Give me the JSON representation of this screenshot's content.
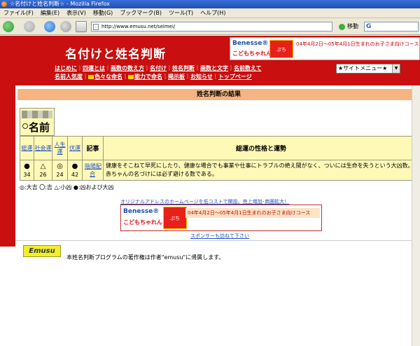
{
  "window": {
    "title": "☆名付けと姓名判断☆ - Mozilla Firefox"
  },
  "menubar": {
    "items": [
      "ファイル(F)",
      "編集(E)",
      "表示(V)",
      "移動(G)",
      "ブックマーク(B)",
      "ツール(T)",
      "ヘルプ(H)"
    ]
  },
  "navbar": {
    "url": "http://www.emusu.net/seimei/",
    "go_label": "移動",
    "search_logo": "G"
  },
  "header": {
    "site_title": "名付けと姓名判断",
    "site_menu": "★サイトメニュー★",
    "links_row1": [
      "はじめに",
      "四運とは",
      "画数の数え方",
      "名付け",
      "姓名判断",
      "画数と文字",
      "名前数えて"
    ],
    "links_row2": [
      "名前人気度",
      "色々な命名",
      "能力で命名",
      "掲示板",
      "お知らせ",
      "トップページ"
    ],
    "tag_new": "NEW",
    "tag_cool": "COOL"
  },
  "ad_top": {
    "brand": "Benesse®",
    "product": "こどもちゃれんじ",
    "tag": "ぷち",
    "text": "04年4月2日～05年4月1日生まれのお子さま向けコース"
  },
  "result": {
    "title": "姓名判断の結果",
    "name_label": "名前",
    "headers": [
      "総運",
      "社会運",
      "人生運",
      "伏運"
    ],
    "symbols": [
      "●",
      "△",
      "◎",
      "●"
    ],
    "numbers": [
      "34",
      "26",
      "24",
      "42"
    ],
    "record_header": "記事",
    "record_link": "陰陽配合",
    "desc_header": "総運の性格と運勢",
    "description": "健康をそこねて早死にしたり、健康な場合でも事業や仕事にトラブルの絶え間がなく、ついには生命を失うという大凶数。赤ちゃんの名づけには必ず避ける数である。"
  },
  "legend": "◎:大吉 〇:吉 △:小凶 ●:凶および大凶",
  "promo_link": "オリジナルアドレスのホームページを低コストで開設。売上増加･商圏拡大！",
  "ad_bottom": {
    "brand": "Benesse®",
    "product": "こどもちゃれんじ",
    "tag": "ぷち",
    "text": "04年4月2日～05年4月1日生まれのお子さま向けコース"
  },
  "sponsor_link": "スポンサーも訪ねて下さい",
  "footer": {
    "logo": "Emusu",
    "copyright": "本姓名判断プログラムの著作権は作者\"emusu\"に帰属します。"
  }
}
